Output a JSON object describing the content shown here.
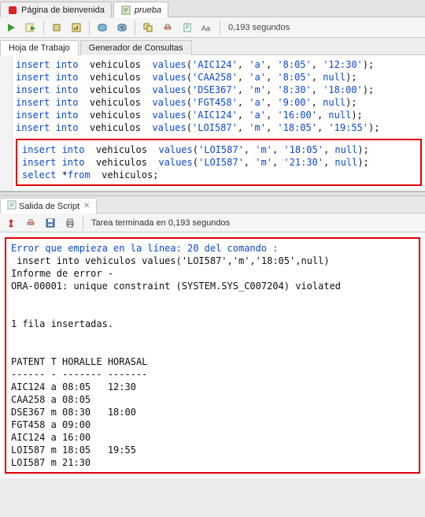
{
  "tabs": [
    {
      "label": "Página de bienvenida",
      "active": false
    },
    {
      "label": "prueba",
      "active": true,
      "italic": true
    }
  ],
  "toolbar": {
    "timing": "0,193 segundos"
  },
  "subtabs": {
    "worksheet": "Hoja de Trabajo",
    "querybuilder": "Generador de Consultas"
  },
  "sql_lines": [
    {
      "parts": [
        [
          "kw",
          "insert into"
        ],
        [
          "",
          "  vehiculos  "
        ],
        [
          "kw",
          "values"
        ],
        [
          "",
          "("
        ],
        [
          "str",
          "'AIC124'"
        ],
        [
          "",
          ", "
        ],
        [
          "str",
          "'a'"
        ],
        [
          "",
          ", "
        ],
        [
          "str",
          "'8:05'"
        ],
        [
          "",
          ", "
        ],
        [
          "str",
          "'12:30'"
        ],
        [
          "",
          ");"
        ]
      ]
    },
    {
      "parts": [
        [
          "kw",
          "insert into"
        ],
        [
          "",
          "  vehiculos  "
        ],
        [
          "kw",
          "values"
        ],
        [
          "",
          "("
        ],
        [
          "str",
          "'CAA258'"
        ],
        [
          "",
          ", "
        ],
        [
          "str",
          "'a'"
        ],
        [
          "",
          ", "
        ],
        [
          "str",
          "'8:05'"
        ],
        [
          "",
          ", "
        ],
        [
          "kw",
          "null"
        ],
        [
          "",
          ");"
        ]
      ]
    },
    {
      "parts": [
        [
          "kw",
          "insert into"
        ],
        [
          "",
          "  vehiculos  "
        ],
        [
          "kw",
          "values"
        ],
        [
          "",
          "("
        ],
        [
          "str",
          "'DSE367'"
        ],
        [
          "",
          ", "
        ],
        [
          "str",
          "'m'"
        ],
        [
          "",
          ", "
        ],
        [
          "str",
          "'8:30'"
        ],
        [
          "",
          ", "
        ],
        [
          "str",
          "'18:00'"
        ],
        [
          "",
          ");"
        ]
      ]
    },
    {
      "parts": [
        [
          "kw",
          "insert into"
        ],
        [
          "",
          "  vehiculos  "
        ],
        [
          "kw",
          "values"
        ],
        [
          "",
          "("
        ],
        [
          "str",
          "'FGT458'"
        ],
        [
          "",
          ", "
        ],
        [
          "str",
          "'a'"
        ],
        [
          "",
          ", "
        ],
        [
          "str",
          "'9:00'"
        ],
        [
          "",
          ", "
        ],
        [
          "kw",
          "null"
        ],
        [
          "",
          ");"
        ]
      ]
    },
    {
      "parts": [
        [
          "kw",
          "insert into"
        ],
        [
          "",
          "  vehiculos  "
        ],
        [
          "kw",
          "values"
        ],
        [
          "",
          "("
        ],
        [
          "str",
          "'AIC124'"
        ],
        [
          "",
          ", "
        ],
        [
          "str",
          "'a'"
        ],
        [
          "",
          ", "
        ],
        [
          "str",
          "'16:00'"
        ],
        [
          "",
          ", "
        ],
        [
          "kw",
          "null"
        ],
        [
          "",
          ");"
        ]
      ]
    },
    {
      "parts": [
        [
          "kw",
          "insert into"
        ],
        [
          "",
          "  vehiculos  "
        ],
        [
          "kw",
          "values"
        ],
        [
          "",
          "("
        ],
        [
          "str",
          "'LOI587'"
        ],
        [
          "",
          ", "
        ],
        [
          "str",
          "'m'"
        ],
        [
          "",
          ", "
        ],
        [
          "str",
          "'18:05'"
        ],
        [
          "",
          ", "
        ],
        [
          "str",
          "'19:55'"
        ],
        [
          "",
          ");"
        ]
      ]
    }
  ],
  "sql_box_lines": [
    {
      "parts": [
        [
          "kw",
          "insert into"
        ],
        [
          "",
          "  vehiculos  "
        ],
        [
          "kw",
          "values"
        ],
        [
          "",
          "("
        ],
        [
          "str",
          "'LOI587'"
        ],
        [
          "",
          ", "
        ],
        [
          "str",
          "'m'"
        ],
        [
          "",
          ", "
        ],
        [
          "str",
          "'18:05'"
        ],
        [
          "",
          ", "
        ],
        [
          "kw",
          "null"
        ],
        [
          "",
          ");"
        ]
      ]
    },
    {
      "parts": [
        [
          "",
          ""
        ]
      ]
    },
    {
      "parts": [
        [
          "kw",
          "insert into"
        ],
        [
          "",
          "  vehiculos  "
        ],
        [
          "kw",
          "values"
        ],
        [
          "",
          "("
        ],
        [
          "str",
          "'LOI587'"
        ],
        [
          "",
          ", "
        ],
        [
          "str",
          "'m'"
        ],
        [
          "",
          ", "
        ],
        [
          "str",
          "'21:30'"
        ],
        [
          "",
          ", "
        ],
        [
          "kw",
          "null"
        ],
        [
          "",
          ");"
        ]
      ]
    },
    {
      "parts": [
        [
          "",
          ""
        ]
      ]
    },
    {
      "parts": [
        [
          "kw",
          "select"
        ],
        [
          "",
          " *"
        ],
        [
          "kw",
          "from"
        ],
        [
          "",
          "  vehiculos;"
        ]
      ]
    }
  ],
  "output_panel": {
    "tab_label": "Salida de Script",
    "status": "Tarea terminada en 0,193 segundos"
  },
  "output_lines": [
    {
      "cls": "err-head",
      "text": "Error que empieza en la línea: 20 del comando :"
    },
    {
      "cls": "",
      "text": " insert into vehiculos values('LOI587','m','18:05',null)"
    },
    {
      "cls": "",
      "text": "Informe de error -"
    },
    {
      "cls": "",
      "text": "ORA-00001: unique constraint (SYSTEM.SYS_C007204) violated"
    },
    {
      "cls": "",
      "text": ""
    },
    {
      "cls": "",
      "text": ""
    },
    {
      "cls": "",
      "text": "1 fila insertadas."
    },
    {
      "cls": "",
      "text": ""
    },
    {
      "cls": "",
      "text": ""
    },
    {
      "cls": "",
      "text": "PATENT T HORALLE HORASAL"
    },
    {
      "cls": "",
      "text": "------ - ------- -------"
    },
    {
      "cls": "",
      "text": "AIC124 a 08:05   12:30"
    },
    {
      "cls": "",
      "text": "CAA258 a 08:05"
    },
    {
      "cls": "",
      "text": "DSE367 m 08:30   18:00"
    },
    {
      "cls": "",
      "text": "FGT458 a 09:00"
    },
    {
      "cls": "",
      "text": "AIC124 a 16:00"
    },
    {
      "cls": "",
      "text": "LOI587 m 18:05   19:55"
    },
    {
      "cls": "",
      "text": "LOI587 m 21:30"
    }
  ]
}
